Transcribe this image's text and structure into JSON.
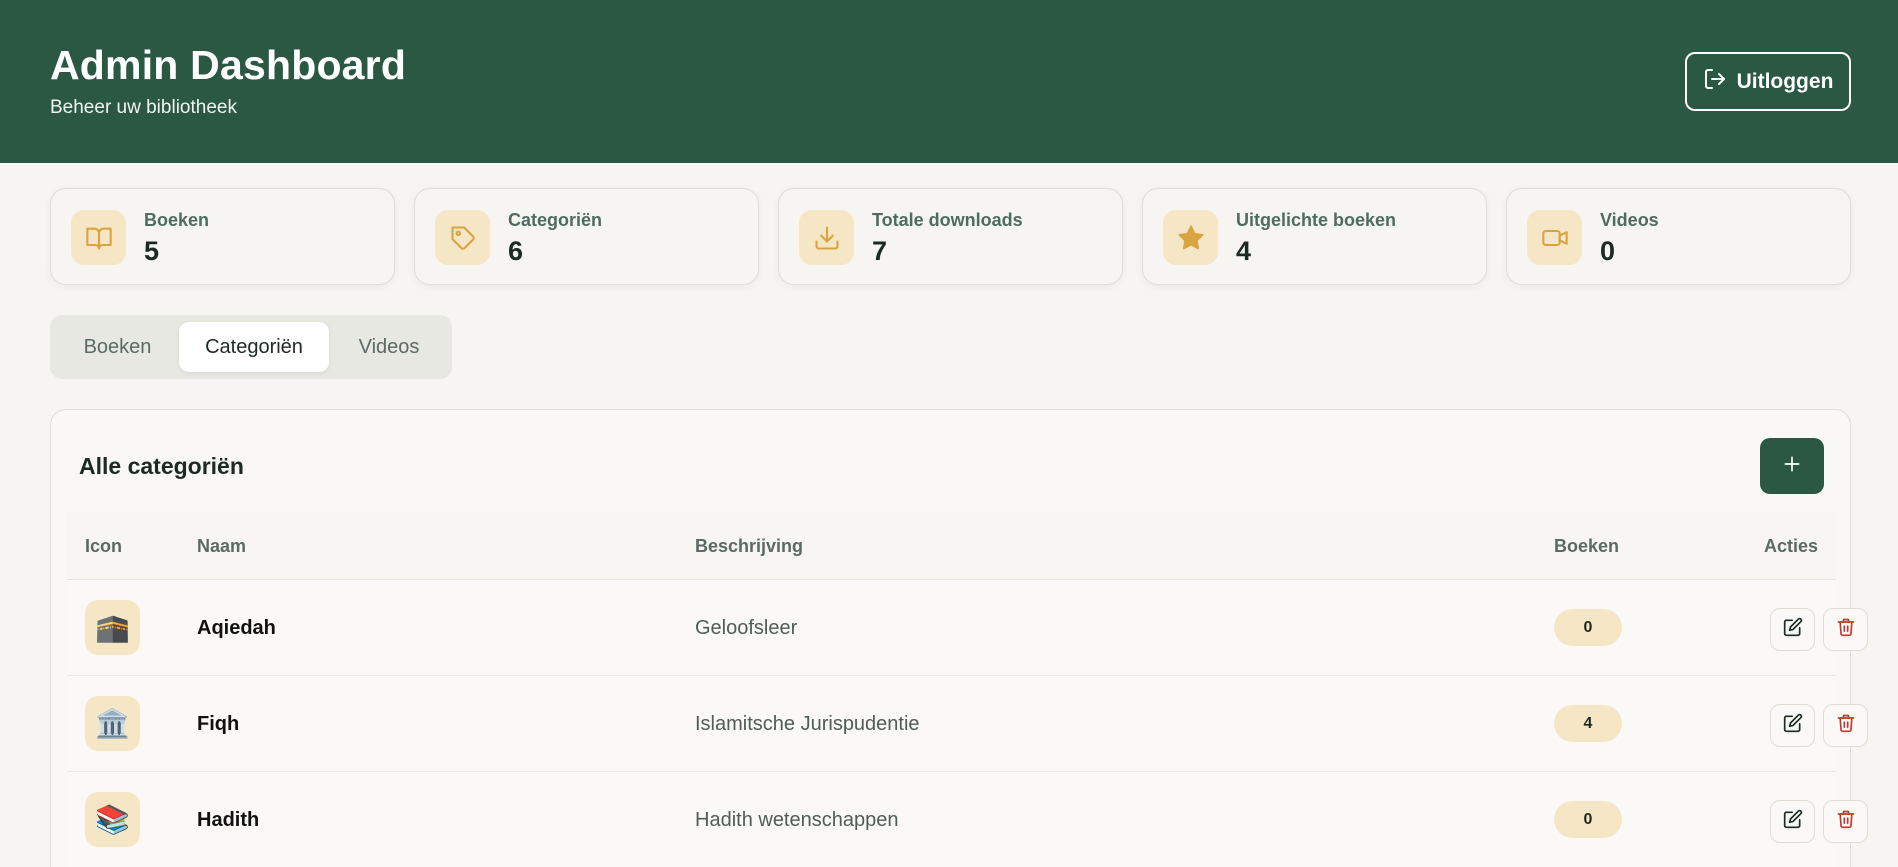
{
  "header": {
    "title": "Admin Dashboard",
    "subtitle": "Beheer uw bibliotheek",
    "logout_label": "Uitloggen",
    "bg_color": "#2b5842"
  },
  "stats": [
    {
      "label": "Boeken",
      "value": "5",
      "icon": "book-icon"
    },
    {
      "label": "Categoriën",
      "value": "6",
      "icon": "tag-icon"
    },
    {
      "label": "Totale downloads",
      "value": "7",
      "icon": "download-icon"
    },
    {
      "label": "Uitgelichte boeken",
      "value": "4",
      "icon": "star-icon"
    },
    {
      "label": "Videos",
      "value": "0",
      "icon": "video-icon"
    }
  ],
  "tabs": [
    {
      "label": "Boeken",
      "active": false
    },
    {
      "label": "Categoriën",
      "active": true
    },
    {
      "label": "Videos",
      "active": false
    }
  ],
  "panel": {
    "title": "Alle categoriën",
    "add_icon": "plus-icon",
    "columns": {
      "icon": "Icon",
      "name": "Naam",
      "description": "Beschrijving",
      "books": "Boeken",
      "actions": "Acties"
    },
    "rows": [
      {
        "icon": "🕋",
        "icon_name": "kaaba-icon",
        "name": "Aqiedah",
        "description": "Geloofsleer",
        "books": "0"
      },
      {
        "icon": "🏛️",
        "icon_name": "classical-building-icon",
        "name": "Fiqh",
        "description": "Islamitsche Jurispudentie",
        "books": "4"
      },
      {
        "icon": "📚",
        "icon_name": "books-icon",
        "name": "Hadith",
        "description": "Hadith wetenschappen",
        "books": "0"
      }
    ]
  },
  "colors": {
    "brand": "#2b5842",
    "accent": "#f5e6c6",
    "icon_accent": "#d9a441",
    "danger": "#c0392b"
  }
}
